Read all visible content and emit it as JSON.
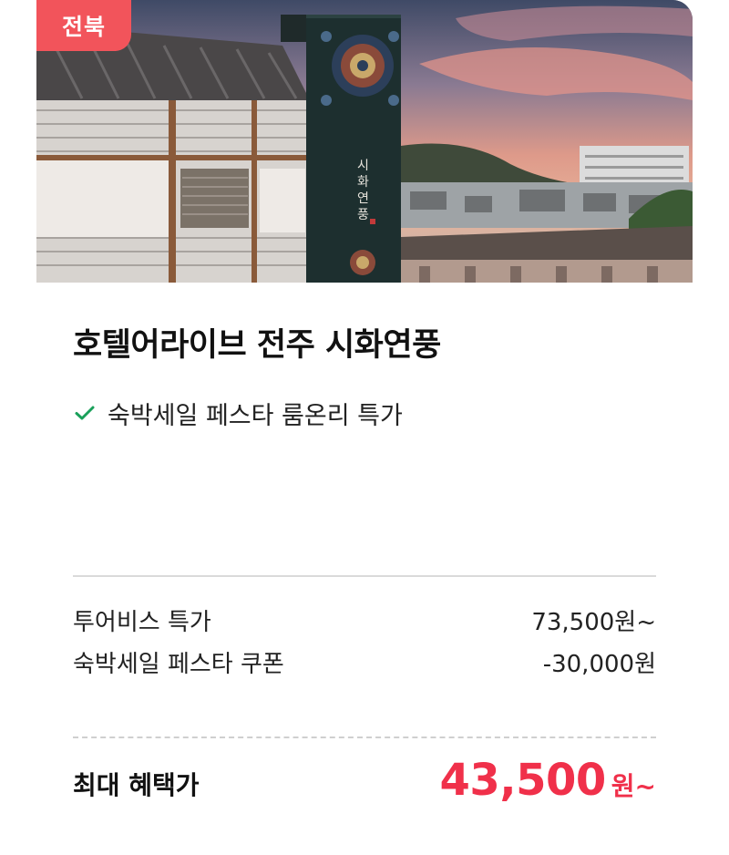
{
  "badge": {
    "region": "전북"
  },
  "product": {
    "title": "호텔어라이브 전주 시화연풍",
    "feature": "숙박세일 페스타 룸온리 특가"
  },
  "prices": [
    {
      "label": "투어비스 특가",
      "value": "73,500원~"
    },
    {
      "label": "숙박세일 페스타 쿠폰",
      "value": "-30,000원"
    }
  ],
  "final": {
    "label": "최대 혜택가",
    "amount": "43,500",
    "unit": "원~"
  },
  "sign_text": "시화연풍",
  "colors": {
    "accent": "#f0304a",
    "badge": "#f2545b",
    "check": "#1aa05a"
  }
}
